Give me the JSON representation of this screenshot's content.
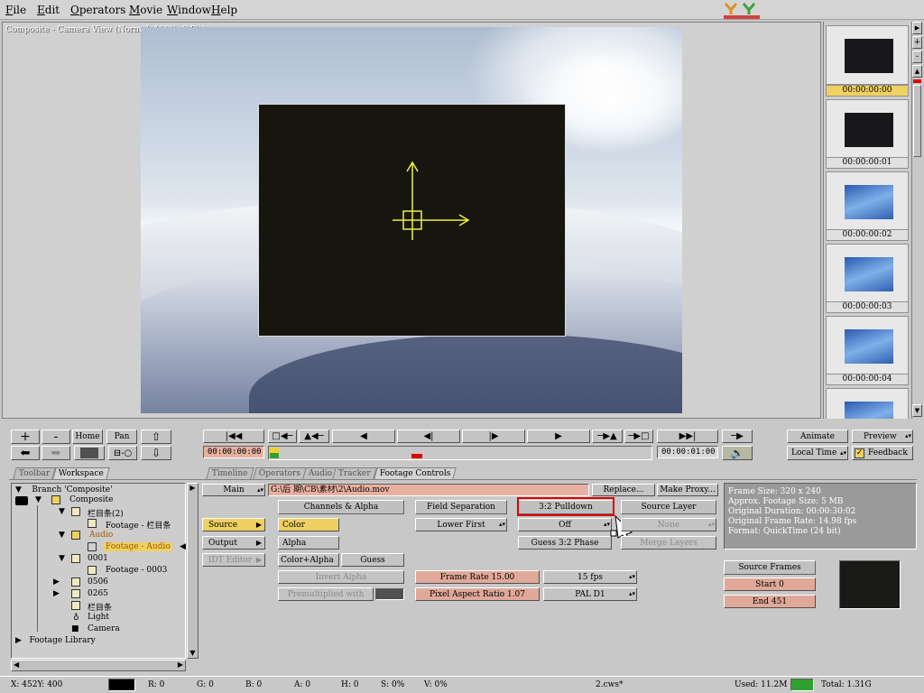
{
  "menubar": {
    "items": [
      {
        "key": "F",
        "rest": "ile"
      },
      {
        "key": "E",
        "rest": "dit"
      },
      {
        "key": "O",
        "rest": "perators"
      },
      {
        "key": "M",
        "rest": "ovie"
      },
      {
        "key": "W",
        "rest": "indow"
      },
      {
        "key": "H",
        "rest": "elp"
      }
    ]
  },
  "viewer": {
    "title": "Composite - Camera View (Normal, 100%, 8 Bit)"
  },
  "thumbnails": {
    "labels": [
      "00:00:00:00",
      "00:00:00:01",
      "00:00:00:02",
      "00:00:00:03",
      "00:00:00:04"
    ],
    "scroll_up": "+",
    "scroll_down": "-"
  },
  "nav": {
    "plus": "+",
    "minus": "-",
    "home": "Home",
    "pan": "Pan"
  },
  "transport": {
    "start_time": "00:00:00:00",
    "end_time": "00:00:01:00"
  },
  "right_controls": {
    "animate": "Animate",
    "preview": "Preview",
    "local_time": "Local Time",
    "feedback": "Feedback"
  },
  "left_tabs": [
    "Toolbar",
    "Workspace"
  ],
  "center_tabs": [
    "Timeline",
    "Operators",
    "Audio",
    "Tracker",
    "Footage Controls"
  ],
  "tree": {
    "branch": "Branch 'Composite'",
    "composite": "Composite",
    "item1": "栏目条(2)",
    "footage1": "Footage - 栏目条",
    "audio": "Audio",
    "footage_audio": "Footage - Audio",
    "n0001": "0001",
    "footage3": "Footage - 0003",
    "n0506": "0506",
    "n0265": "0265",
    "item_plain": "栏目条",
    "light": "Light",
    "camera": "Camera",
    "library": "Footage Library"
  },
  "footage": {
    "main_select": "Main",
    "path": "G:\\后 期\\CB\\素材\\2\\Audio.mov",
    "replace": "Replace...",
    "make_proxy": "Make Proxy...",
    "side_source": "Source",
    "side_output": "Output",
    "side_idt": "IDT Editor",
    "channels_header": "Channels & Alpha",
    "color": "Color",
    "alpha": "Alpha",
    "color_alpha": "Color+Alpha",
    "guess": "Guess",
    "invert_alpha": "Invert Alpha",
    "premultiplied": "Premultiplied with",
    "field_sep_header": "Field Separation",
    "lower_first": "Lower First",
    "pulldown_header": "3:2 Pulldown",
    "off": "Off",
    "guess_phase": "Guess 3:2 Phase",
    "source_layer_header": "Source Layer",
    "none": "None",
    "merge_layers": "Merge Layers",
    "frame_rate": "Frame Rate 15.00",
    "fps": "15 fps",
    "pixel_aspect": "Pixel Aspect Ratio 1.07",
    "pal": "PAL D1",
    "source_frames": "Source Frames",
    "start": "Start 0",
    "end": "End 451"
  },
  "info": {
    "lines": [
      "Frame Size: 320 x 240",
      "Approx. Footage Size:     5 MB",
      "Original Duration: 00:00:30:02",
      "Original Frame Rate: 14.98 fps",
      "Format: QuickTime (24 bit)"
    ]
  },
  "status": {
    "x": "X:   452Y:  400",
    "r": "R: 0",
    "g": "G: 0",
    "b": "B: 0",
    "a": "A: 0",
    "h": "H: 0",
    "s": "S: 0%",
    "v": "V: 0%",
    "file": "2.cws*",
    "used": "Used: 11.2M",
    "total": "Total: 1.31G"
  },
  "colors": {
    "accent_yellow": "#f0d060",
    "salmon": "#e0a898",
    "highlight_red": "#e00000"
  }
}
